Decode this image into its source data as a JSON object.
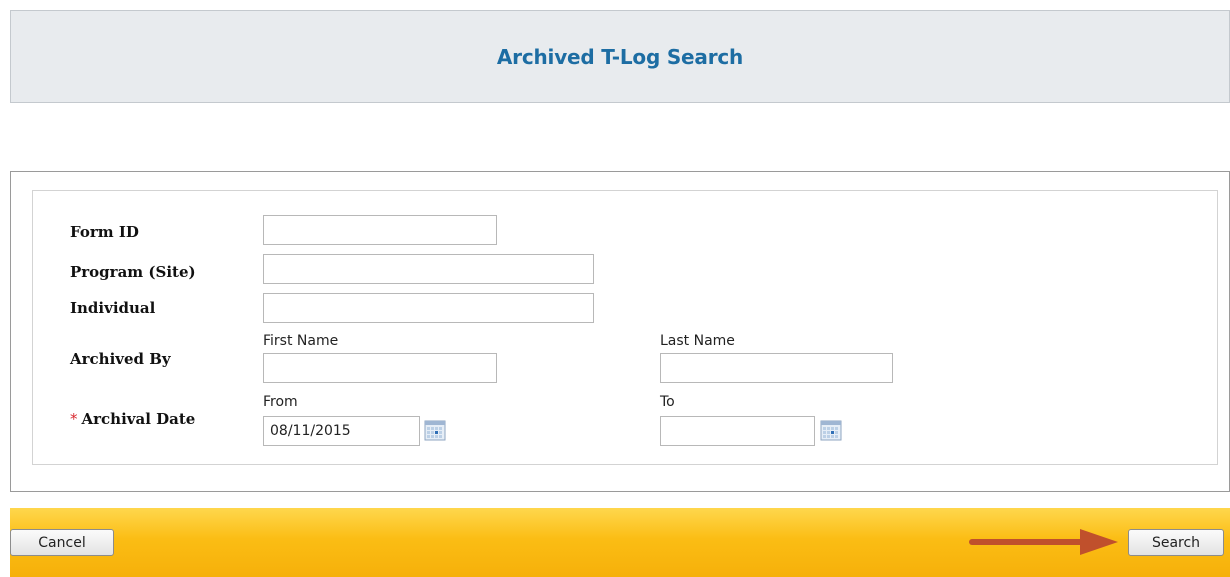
{
  "header": {
    "title": "Archived T-Log Search"
  },
  "form": {
    "form_id": {
      "label": "Form ID",
      "value": ""
    },
    "program": {
      "label": "Program (Site)",
      "value": ""
    },
    "individual": {
      "label": "Individual",
      "value": ""
    },
    "archived_by": {
      "label": "Archived By",
      "first_name_label": "First Name",
      "first_name_value": "",
      "last_name_label": "Last Name",
      "last_name_value": ""
    },
    "archival_date": {
      "required_marker": "*",
      "label": "Archival Date",
      "from_label": "From",
      "from_value": "08/11/2015",
      "to_label": "To",
      "to_value": ""
    }
  },
  "footer": {
    "cancel_label": "Cancel",
    "search_label": "Search"
  },
  "colors": {
    "title": "#1d6da3",
    "footer_bar": "#fbbd14",
    "arrow": "#c0502c",
    "required": "#d8292f"
  },
  "icons": {
    "calendar": "calendar-icon",
    "pointer": "arrow-right-icon"
  }
}
